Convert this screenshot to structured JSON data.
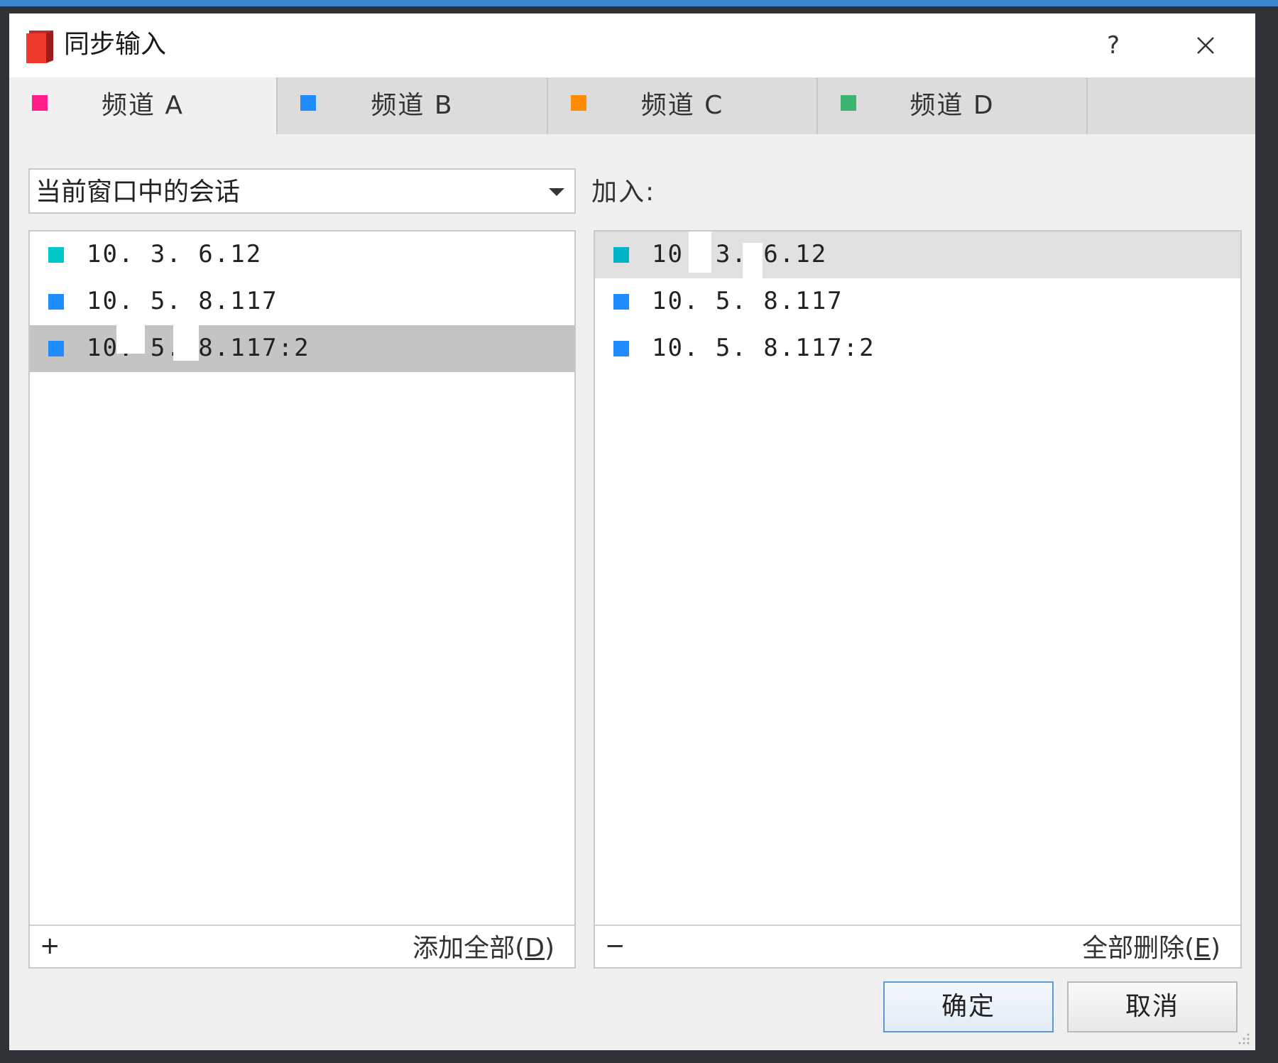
{
  "window": {
    "title": "同步输入",
    "help_label": "?",
    "icons": {
      "app": "app-logo-icon",
      "close": "close-icon",
      "dropdown": "chevron-down-icon",
      "resize": "resize-grip-icon"
    }
  },
  "tabs": [
    {
      "label": "频道 A",
      "color": "#ff1e8c",
      "active": true
    },
    {
      "label": "频道 B",
      "color": "#1e8cff",
      "active": false
    },
    {
      "label": "频道 C",
      "color": "#ff8c00",
      "active": false
    },
    {
      "label": "频道 D",
      "color": "#3cb371",
      "active": false
    }
  ],
  "source": {
    "selected": "当前窗口中的会话",
    "sessions": [
      {
        "ip": "10.  3.  6.12",
        "color": "#00c8c8"
      },
      {
        "ip": "10.  5.  8.117",
        "color": "#1e8cff"
      },
      {
        "ip": "10.  5.  8.117:2",
        "color": "#1e8cff",
        "selected": true
      }
    ],
    "add_sign": "+",
    "add_all_label": "添加全部(",
    "add_all_key": "D",
    "add_all_close": ")"
  },
  "joined": {
    "label": "加入:",
    "sessions": [
      {
        "ip": "10.  3.  6.12",
        "color": "#00c8c8",
        "selected": true
      },
      {
        "ip": "10.  5.  8.117",
        "color": "#1e8cff"
      },
      {
        "ip": "10.  5.  8.117:2",
        "color": "#1e8cff"
      }
    ],
    "remove_sign": "−",
    "remove_all_label": "全部删除(",
    "remove_all_key": "E",
    "remove_all_close": ")"
  },
  "buttons": {
    "ok": "确定",
    "cancel": "取消"
  }
}
